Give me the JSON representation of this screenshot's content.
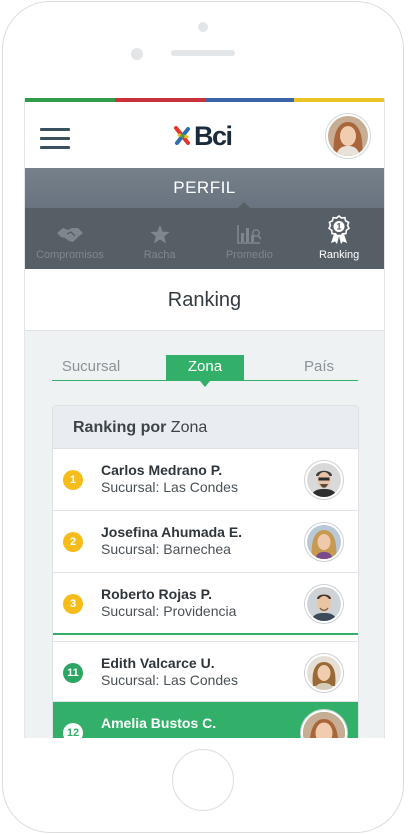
{
  "colors": {
    "strip": [
      "#2f9c4a",
      "#c8303a",
      "#3a63a8",
      "#e9c226"
    ],
    "accent_green": "#32b069",
    "rank_gold": "#f5bc1c",
    "rank_green": "#2da563"
  },
  "header": {
    "menu_icon": "hamburger-icon",
    "logo_text": "Bci",
    "avatar": "user-avatar"
  },
  "perfil": {
    "title": "PERFIL"
  },
  "tabs": [
    {
      "label": "Compromisos",
      "icon": "handshake-icon",
      "active": false
    },
    {
      "label": "Racha",
      "icon": "star-icon",
      "active": false
    },
    {
      "label": "Promedio",
      "icon": "chart-icon",
      "active": false
    },
    {
      "label": "Ranking",
      "icon": "medal-icon",
      "active": true
    }
  ],
  "section": {
    "title": "Ranking"
  },
  "subtabs": [
    {
      "label": "Sucursal",
      "active": false
    },
    {
      "label": "Zona",
      "active": true
    },
    {
      "label": "País",
      "active": false
    }
  ],
  "card": {
    "header_bold": "Ranking por",
    "header_rest": " Zona"
  },
  "ranking": [
    {
      "rank": "1",
      "name": "Carlos Medrano P.",
      "branch": "Sucursal: Las Condes"
    },
    {
      "rank": "2",
      "name": "Josefina Ahumada E.",
      "branch": "Sucursal: Barnechea"
    },
    {
      "rank": "3",
      "name": "Roberto Rojas P.",
      "branch": "Sucursal: Providencia"
    },
    {
      "rank": "11",
      "name": "Edith Valcarce U.",
      "branch": "Sucursal: Las Condes"
    },
    {
      "rank": "12",
      "name": "Amelia Bustos C.",
      "branch": ""
    }
  ]
}
